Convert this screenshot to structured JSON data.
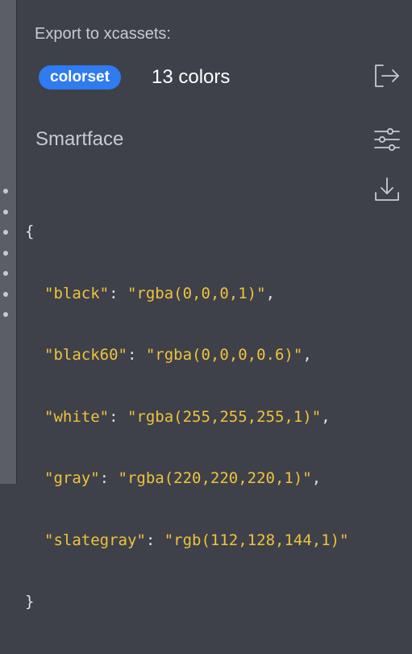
{
  "export": {
    "title": "Export to xcassets:",
    "format_badge": "colorset",
    "count_label": "13 colors"
  },
  "section": {
    "title": "Smartface"
  },
  "icons": {
    "export": "export-arrow-icon",
    "settings": "sliders-icon",
    "download": "download-icon"
  },
  "code": {
    "open_brace": "{",
    "close_brace": "}",
    "entries": [
      {
        "key": "\"black\"",
        "value": "\"rgba(0,0,0,1)\"",
        "trail": ","
      },
      {
        "key": "\"black60\"",
        "value": "\"rgba(0,0,0,0.6)\"",
        "trail": ","
      },
      {
        "key": "\"white\"",
        "value": "\"rgba(255,255,255,1)\"",
        "trail": ","
      },
      {
        "key": "\"gray\"",
        "value": "\"rgba(220,220,220,1)\"",
        "trail": ","
      },
      {
        "key": "\"slategray\"",
        "value": "\"rgb(112,128,144,1)\"",
        "trail": ""
      }
    ]
  },
  "colors": {
    "background": "#3e4149",
    "accent": "#2f7bf0",
    "string": "#f0c23e",
    "muted_text": "#c8cad0"
  }
}
